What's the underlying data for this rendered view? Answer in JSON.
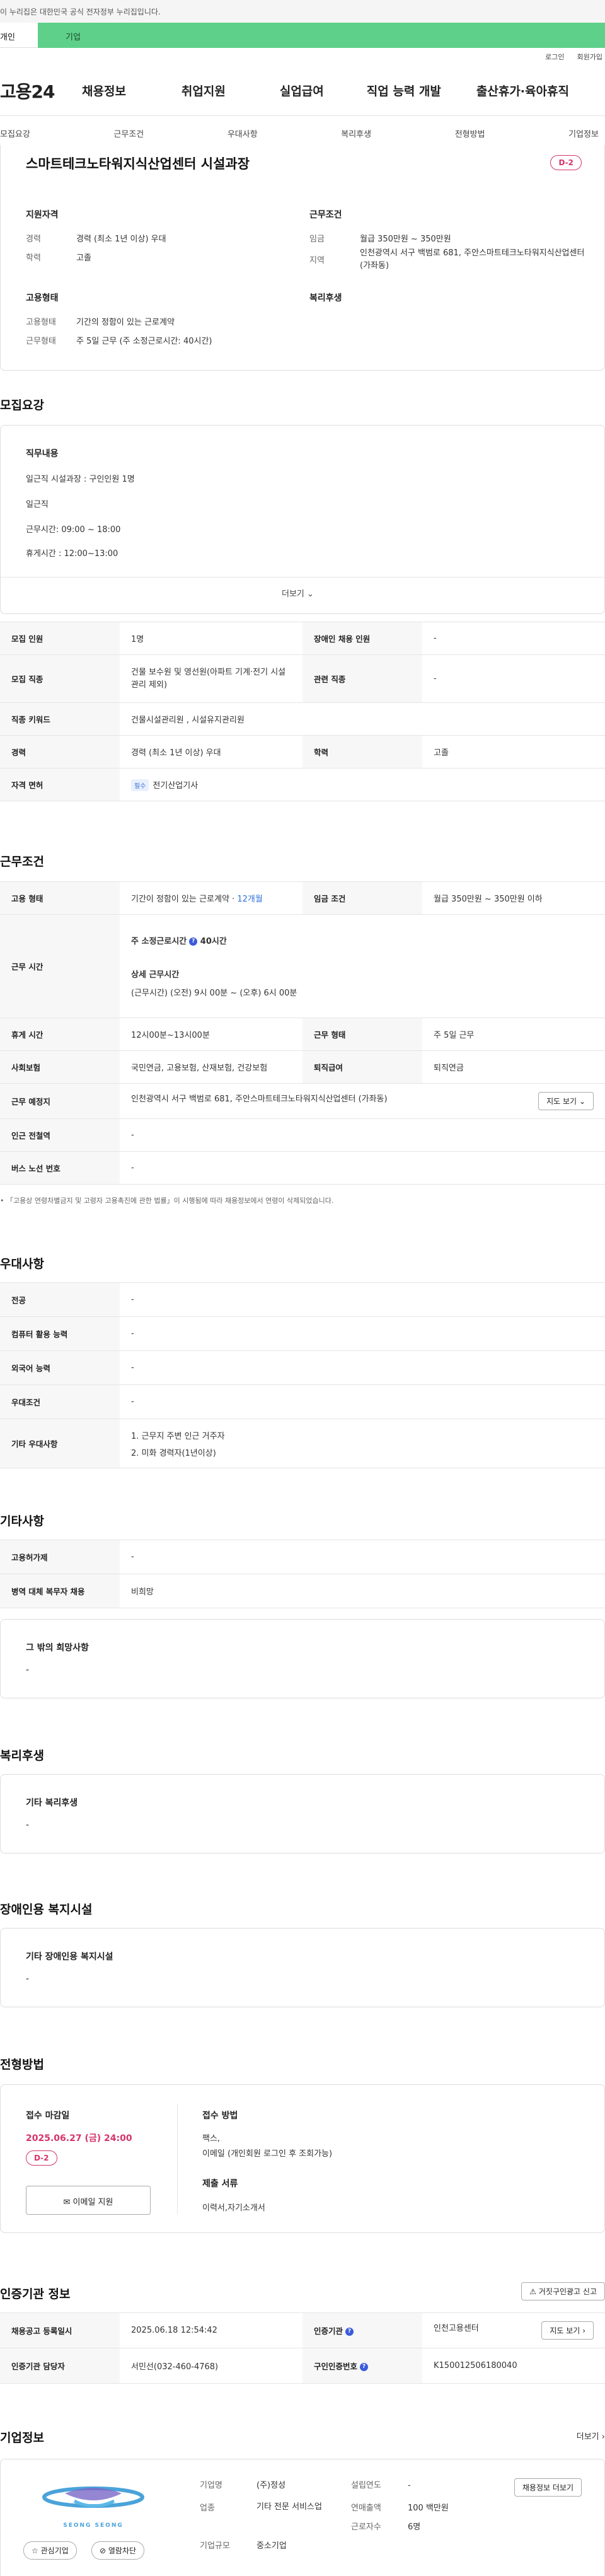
{
  "notice": "이 누리집은 대한민국 공식 전자정부 누리집입니다.",
  "user_tabs": {
    "person": "개인",
    "company": "기업"
  },
  "util": [
    "로그인",
    "회원가입"
  ],
  "logo": "고용24",
  "gnb": [
    "채용정보",
    "취업지원",
    "실업급여",
    "직업 능력 개발",
    "출산휴가·육아휴직"
  ],
  "subnav": [
    "모집요강",
    "근무조건",
    "우대사항",
    "복리후생",
    "전형방법",
    "기업정보"
  ],
  "summary": {
    "title": "스마트테크노타워지식산업센터 시설과장",
    "dday": "D-2",
    "qual_title": "지원자격",
    "qual": [
      {
        "k": "경력",
        "v": "경력 (최소 1년 이상) 우대"
      },
      {
        "k": "학력",
        "v": "고졸"
      }
    ],
    "cond_title": "근무조건",
    "cond": [
      {
        "k": "임금",
        "v": "월급 350만원 ~ 350만원"
      },
      {
        "k": "지역",
        "v": "인천광역시 서구 백범로 681, 주안스마트테크노타워지식산업센터 (가좌동)"
      }
    ],
    "emp_title": "고용형태",
    "emp": [
      {
        "k": "고용형태",
        "v": "기간의 정함이 있는 근로계약"
      },
      {
        "k": "근무형태",
        "v": "주 5일 근무 (주 소정근로시간: 40시간)"
      }
    ],
    "welfare_title": "복리후생"
  },
  "recruit": {
    "title": "모집요강",
    "job_title": "직무내용",
    "job_lines": [
      "일근직 시설과장 : 구인인원 1명",
      "일근직",
      "근무시간: 09:00 ~ 18:00",
      "휴게시간 : 12:00~13:00"
    ],
    "more": "더보기",
    "rows": [
      [
        "모집 인원",
        "1명",
        "장애인 채용 인원",
        "-"
      ],
      [
        "모집 직종",
        "건물 보수원 및 영선원(아파트 기계·전기 시설관리 제외)",
        "관련 직종",
        "-"
      ],
      [
        "직종 키워드",
        "건물시설관리원 , 시설유지관리원"
      ],
      [
        "경력",
        "경력 (최소 1년 이상) 우대",
        "학력",
        "고졸"
      ],
      [
        "자격 면허",
        "필수",
        "전기산업기사"
      ]
    ]
  },
  "work": {
    "title": "근무조건",
    "emp_label": "고용 형태",
    "emp_val": "기간이 정함이 있는 근로계약 · ",
    "emp_period": "12개월",
    "pay_label": "임금 조건",
    "pay_val": "월급 350만원 ~ 350만원 이하",
    "time_label": "근무 시간",
    "time_week": "주 소정근로시간",
    "time_hours": "40시간",
    "time_detail_title": "상세 근무시간",
    "time_detail": "(근무시간) (오전) 9시 00분 ~ (오후) 6시 00분",
    "rows": [
      [
        "휴게 시간",
        "12시00분~13시00분",
        "근무 형태",
        "주 5일 근무"
      ],
      [
        "사회보험",
        "국민연금, 고용보험, 산재보험, 건강보험",
        "퇴직급여",
        "퇴직연금"
      ]
    ],
    "loc_label": "근무 예정지",
    "loc_val": "인천광역시 서구 백범로 681, 주안스마트테크노타워지식산업센터 (가좌동)",
    "map_btn": "지도 보기",
    "subway_label": "인근 전철역",
    "subway_val": "-",
    "bus_label": "버스 노선 번호",
    "bus_val": "-",
    "footnote": "「고용상 연령차별금지 및 고령자 고용촉진에 관한 법률」이 시행됨에 따라 채용정보에서 연령이 삭제되었습니다."
  },
  "pref": {
    "title": "우대사항",
    "rows": [
      [
        "전공",
        "-"
      ],
      [
        "컴퓨터 활용 능력",
        "-"
      ],
      [
        "외국어 능력",
        "-"
      ],
      [
        "우대조건",
        "-"
      ]
    ],
    "etc_label": "기타 우대사항",
    "etc": [
      "1. 근무지 주변 인근 거주자",
      "2. 미화 경력자(1년이상)"
    ]
  },
  "other": {
    "title": "기타사항",
    "rows": [
      [
        "고용허가제",
        "-"
      ],
      [
        "병역 대체 복무자 채용",
        "비희망"
      ]
    ],
    "box_title": "그 밖의 희망사항",
    "box_val": "-"
  },
  "welfare": {
    "title": "복리후생",
    "box_title": "기타 복리후생",
    "box_val": "-"
  },
  "disabled": {
    "title": "장애인용 복지시설",
    "box_title": "기타 장애인용 복지시설",
    "box_val": "-"
  },
  "selection": {
    "title": "전형방법",
    "deadline_title": "접수 마감일",
    "deadline": "2025.06.27 (금) 24:00",
    "dday": "D-2",
    "email_btn": "이메일 지원",
    "method_title": "접수 방법",
    "method": [
      "팩스,",
      "이메일 (개인회원 로그인 후 조회가능)"
    ],
    "docs_title": "제출 서류",
    "docs": "이력서,자기소개서"
  },
  "agency": {
    "title": "인증기관 정보",
    "report_btn": "거짓구인광고 신고",
    "rows": [
      [
        "채용공고 등록일시",
        "2025.06.18 12:54:42",
        "인증기관",
        "인천고용센터"
      ],
      [
        "인증기관 담당자",
        "서민선(032-460-4768)",
        "구인인증번호",
        "K150012506180040"
      ]
    ],
    "map_btn": "지도 보기"
  },
  "company": {
    "title": "기업정보",
    "more": "더보기",
    "logo_text": "SEONG SEONG",
    "interest_btn": "관심기업",
    "block_btn": "열람차단",
    "fields": [
      [
        "기업명",
        "(주)정성"
      ],
      [
        "업종",
        "기타 전문 서비스업"
      ],
      [
        "기업규모",
        "중소기업"
      ]
    ],
    "fields2": [
      [
        "설립연도",
        "-"
      ],
      [
        "연매출액",
        "100 백만원"
      ],
      [
        "근로자수",
        "6명"
      ]
    ],
    "recruit_btn": "채용정보 더보기"
  },
  "colors": {
    "accent": "#d6336c",
    "brand_green": "#5fd08a",
    "blue": "#2f6fd6"
  }
}
